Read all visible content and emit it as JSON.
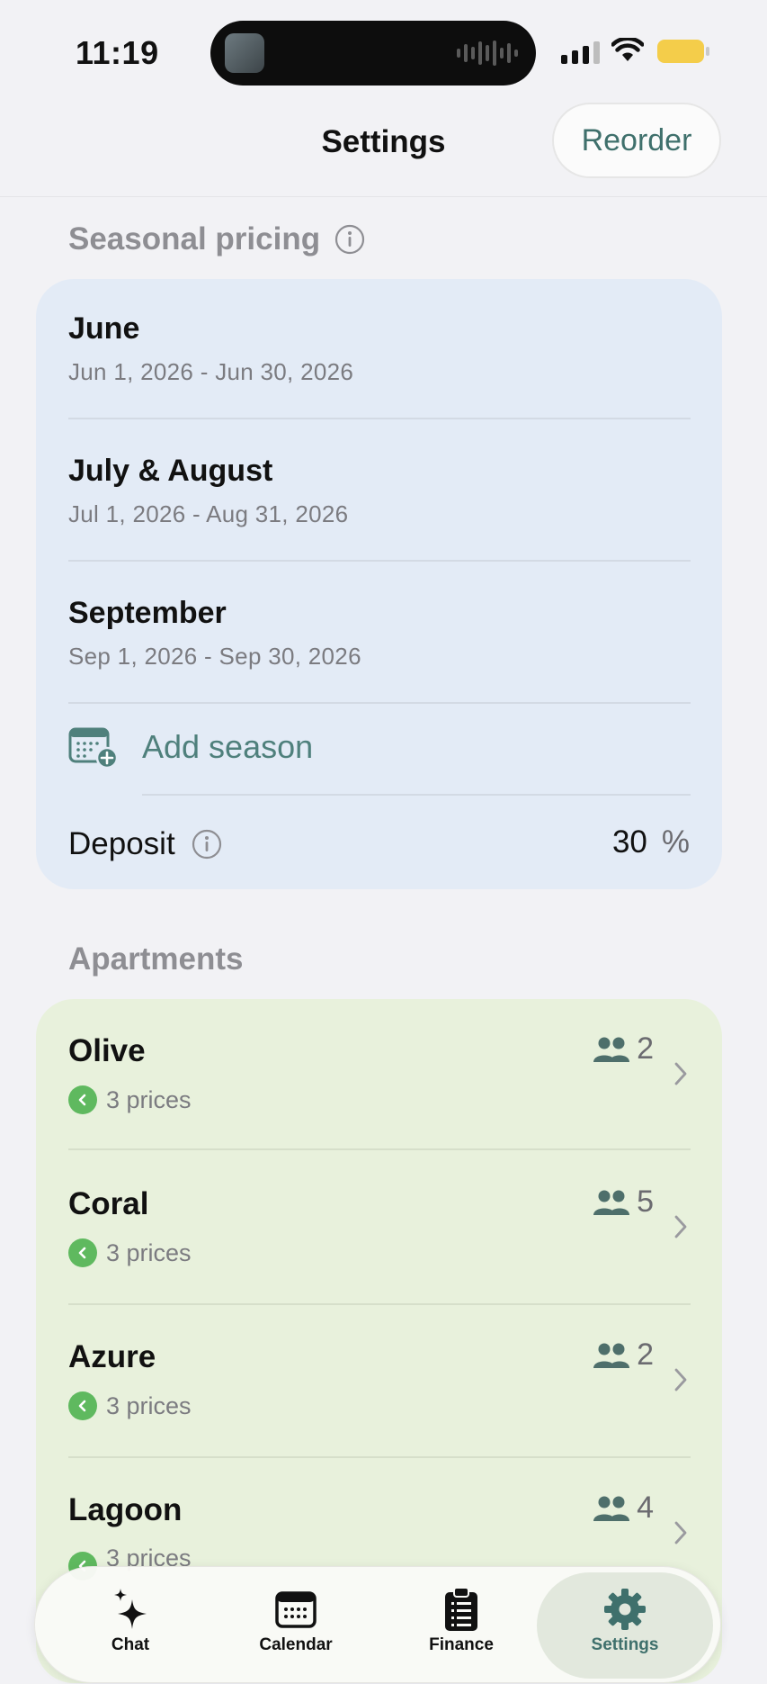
{
  "status_bar": {
    "time": "11:19"
  },
  "header": {
    "title": "Settings",
    "reorder_label": "Reorder"
  },
  "seasonal": {
    "section_label": "Seasonal pricing",
    "seasons": [
      {
        "name": "June",
        "range": "Jun 1, 2026 - Jun 30, 2026"
      },
      {
        "name": "July & August",
        "range": "Jul 1, 2026 - Aug 31, 2026"
      },
      {
        "name": "September",
        "range": "Sep 1, 2026 - Sep 30, 2026"
      }
    ],
    "add_label": "Add season",
    "deposit_label": "Deposit",
    "deposit_value": "30",
    "deposit_unit": "%"
  },
  "apartments": {
    "section_label": "Apartments",
    "items": [
      {
        "name": "Olive",
        "prices": "3 prices",
        "guests": "2"
      },
      {
        "name": "Coral",
        "prices": "3 prices",
        "guests": "5"
      },
      {
        "name": "Azure",
        "prices": "3 prices",
        "guests": "2"
      },
      {
        "name": "Lagoon",
        "prices": "3 prices",
        "guests": "4"
      }
    ]
  },
  "tabs": [
    {
      "label": "Chat",
      "icon": "sparkle-icon"
    },
    {
      "label": "Calendar",
      "icon": "calendar-icon"
    },
    {
      "label": "Finance",
      "icon": "clipboard-icon"
    },
    {
      "label": "Settings",
      "icon": "gear-icon",
      "active": true
    }
  ],
  "colors": {
    "accent": "#3f706c",
    "seasonal_card": "#e3ebf6",
    "apartments_card": "#e8f1dc",
    "price_badge": "#5fb95f"
  }
}
